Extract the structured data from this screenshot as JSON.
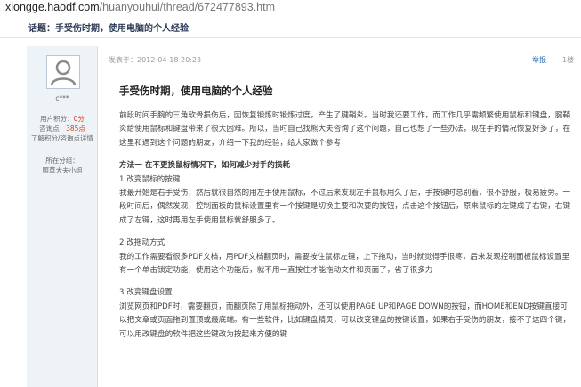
{
  "browser": {
    "url_host": "xiongge.haodf.com",
    "url_path": "/huanyouhui/thread/672477893.htm"
  },
  "topic": {
    "text": "话题：手受伤时期，使用电脑的个人经验"
  },
  "author": {
    "name": "c***",
    "points_label": "用户积分：",
    "points_value": "0分",
    "coin_label": "咨询点：",
    "coin_value": "385点",
    "rules_link": "了解积分/咨询点详情",
    "group_label": "所在分组：",
    "group_link": "照草大夫小组"
  },
  "post": {
    "meta": "发表于：2012-04-18 20:23",
    "report": "举报",
    "floor": "1楼",
    "title": "手受伤时期，使用电脑的个人经验",
    "intro": "前段时间手腕的三角软骨损伤后，因恢复锻炼时锻炼过度，产生了腱鞘炎。当时我还要工作，而工作几乎需频繁使用鼠标和键盘，腱鞘炎给使用鼠标和键盘带来了很大困难。所以，当时自己找熊大夫咨询了这个问题，自己也想了一些办法，现在手的情况恢复好多了，在这里和遇到这个问题的朋友，介绍一下我的经验，给大家做个参考",
    "method_title": "方法一 在不更换鼠标情况下，如何减少对手的损耗",
    "s1_title": "1 改变鼠标的按键",
    "s1_text": "我最开始是右手受伤，然后就很自然的用左手使用鼠标，不过后来发现左手鼠标用久了后，手按键时总别着，很不舒服，极易疲劳。一段时间后，偶然发现，控制面板的鼠标设置里有一个按键是切换主要和次要的按钮，点击这个按钮后，原来鼠标的左键成了右键，右键成了左键，这时再用左手使用鼠标就舒服多了。",
    "s2_title": "2 改拖动方式",
    "s2_text": "我的工作需要看很多PDF文档，用PDF文档翻页时，需要按住鼠标左键，上下拖动，当时就觉得手很疼，后来发现控制面板鼠标设置里有一个单击锁定功能，使用这个功能后，就不用一直按住才能拖动文件和页面了，省了很多力",
    "s3_title": "3 改变键盘设置",
    "s3_text": "浏览网页和PDF时，需要翻页，而翻页除了用鼠标拖动外，还可以使用PAGE UP和PAGE DOWN的按钮，而HOME和END按键直接可以把文章或页面拖到置顶或最底端。有一些软件，比如键盘精灵，可以改变键盘的按键设置，如果右手受伤的朋友，接不了这四个键，可以用改键盘的软件把这些键改为按起来方便的键"
  }
}
